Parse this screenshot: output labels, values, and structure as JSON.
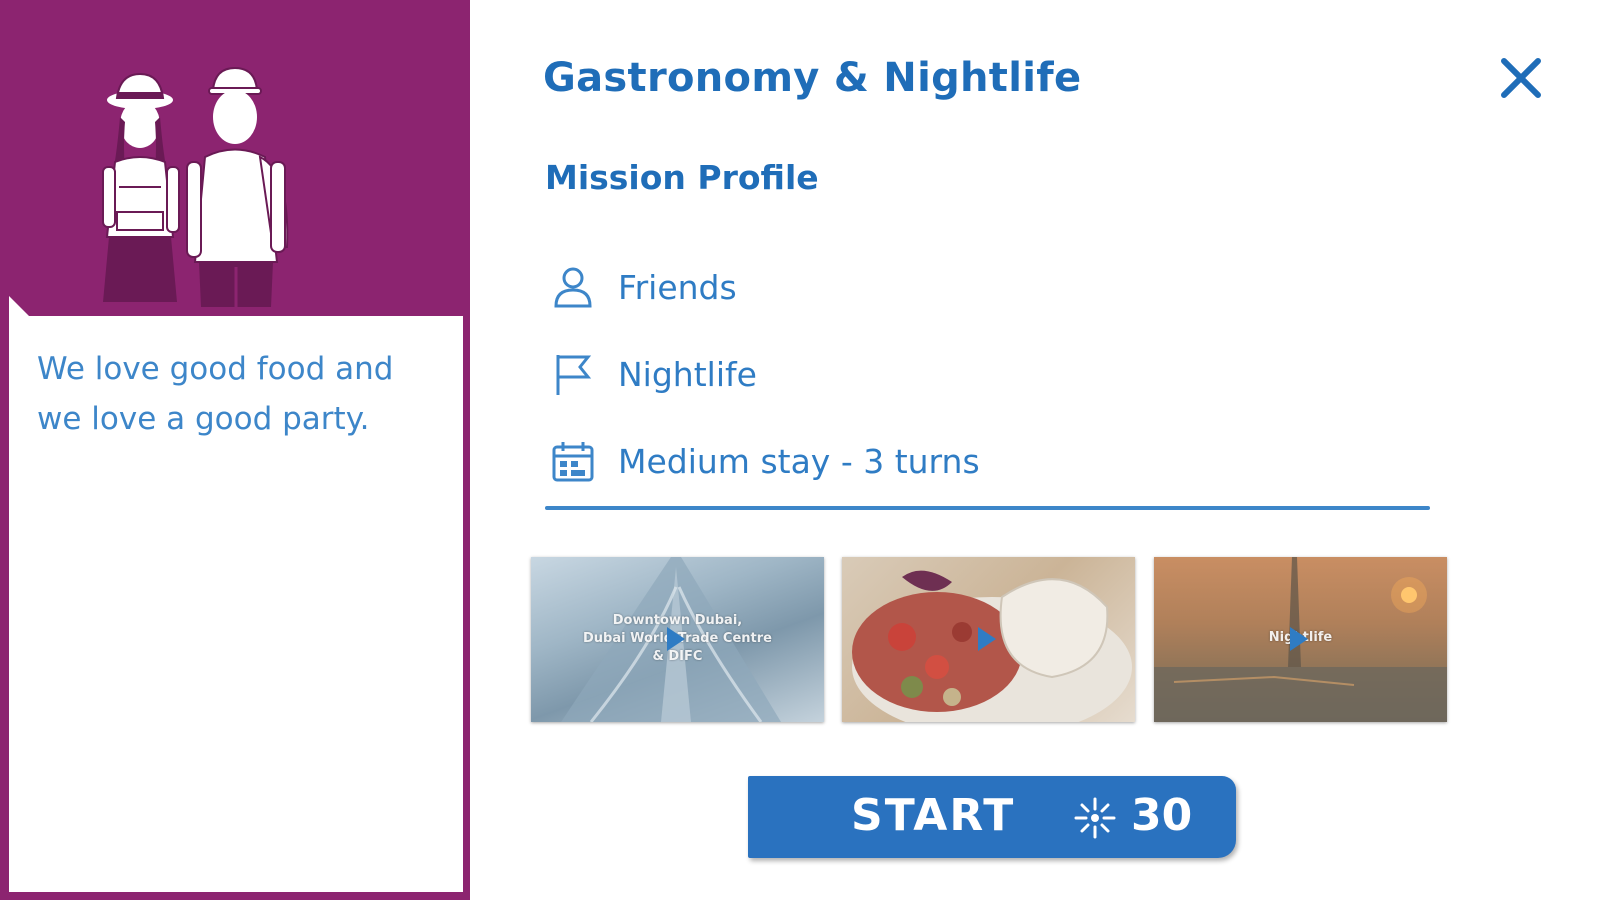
{
  "panel": {
    "accent_color": "#8c2470",
    "quote_line1": "We love good food and",
    "quote_line2": "we love a good party."
  },
  "mission": {
    "title": "Gastronomy & Nightlife",
    "profile_heading": "Mission Profile",
    "items": [
      {
        "icon": "person-icon",
        "label": "Friends"
      },
      {
        "icon": "flag-icon",
        "label": "Nightlife"
      },
      {
        "icon": "calendar-icon",
        "label": "Medium stay - 3 turns"
      }
    ],
    "accent_color": "#1f6db8"
  },
  "videos": [
    {
      "caption_line1": "Downtown Dubai,",
      "caption_line2": "Dubai World Trade Centre",
      "caption_line3": "& DIFC"
    },
    {
      "caption_line1": ""
    },
    {
      "caption_line1": "Nightlife"
    }
  ],
  "start": {
    "label": "START",
    "cost_icon": "sparkle-icon",
    "cost": "30",
    "color": "#2a72bf"
  }
}
